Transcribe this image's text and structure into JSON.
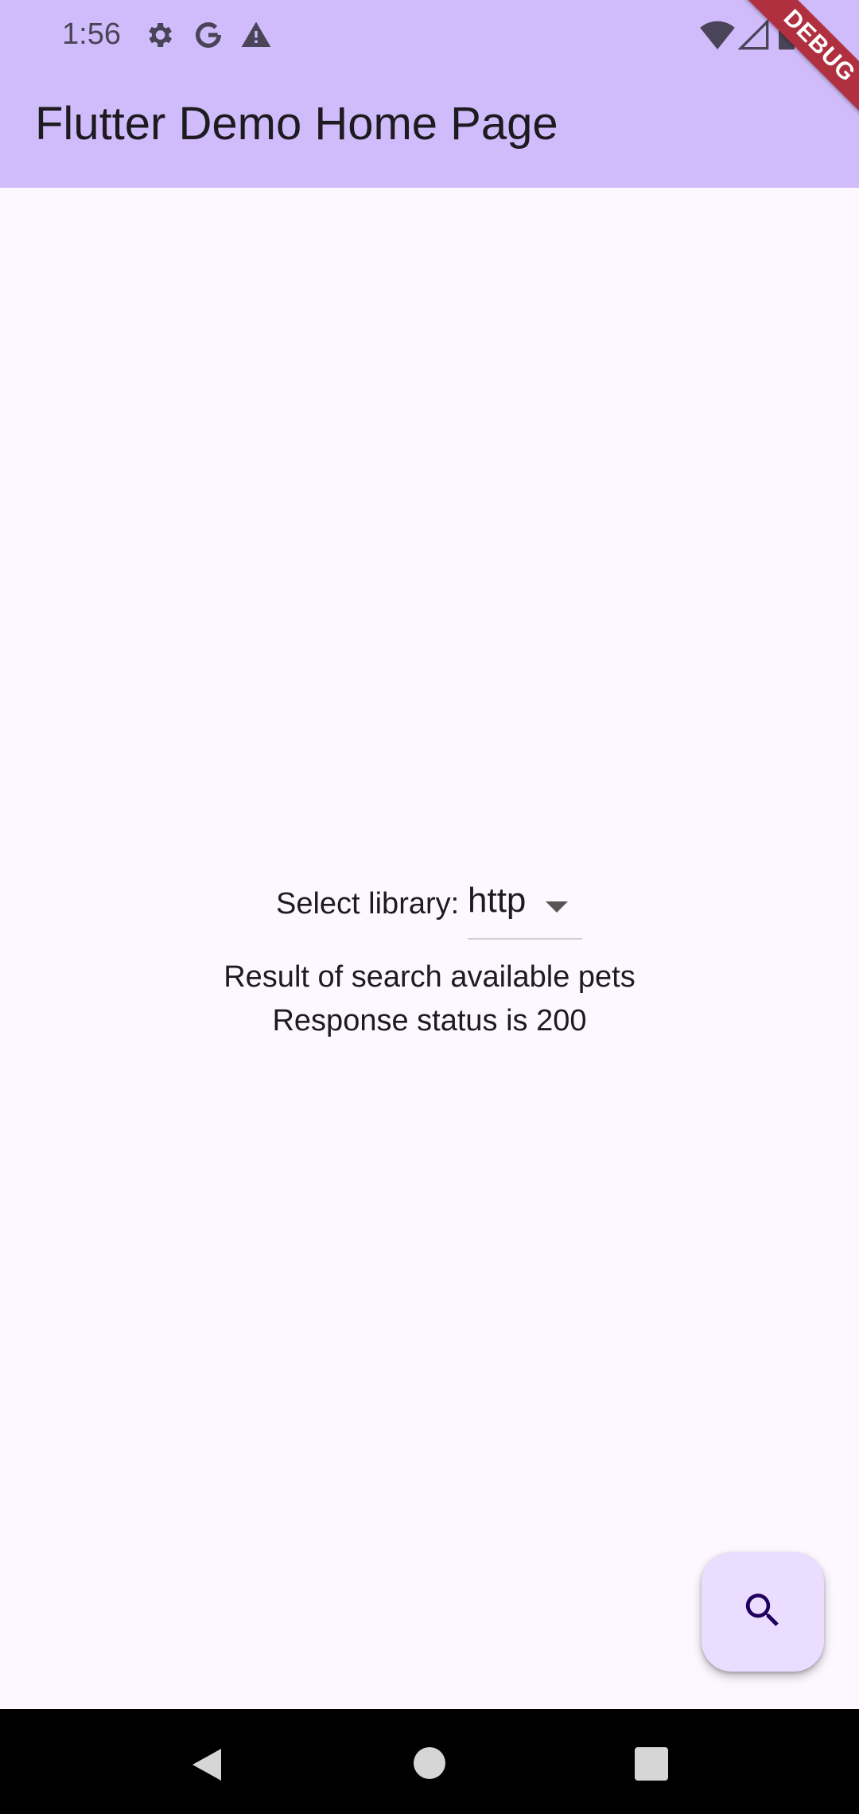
{
  "status_bar": {
    "time": "1:56",
    "left_icons": [
      "settings-icon",
      "google-icon",
      "warning-icon"
    ],
    "right_icons": [
      "wifi-icon",
      "signal-icon",
      "battery-icon"
    ]
  },
  "debug_banner": {
    "label": "DEBUG"
  },
  "app_bar": {
    "title": "Flutter Demo Home Page"
  },
  "main": {
    "select_label": "Select library:",
    "selected_library": "http",
    "result_title": "Result of search available pets",
    "result_status": "Response status is 200"
  },
  "fab": {
    "icon": "search-icon"
  },
  "nav_bar": {
    "buttons": [
      "back-icon",
      "home-icon",
      "recents-icon"
    ]
  },
  "colors": {
    "app_bar": "#d1bcfb",
    "background": "#fdf7ff",
    "fab": "#eaddff",
    "debug_banner": "#b0303f"
  }
}
